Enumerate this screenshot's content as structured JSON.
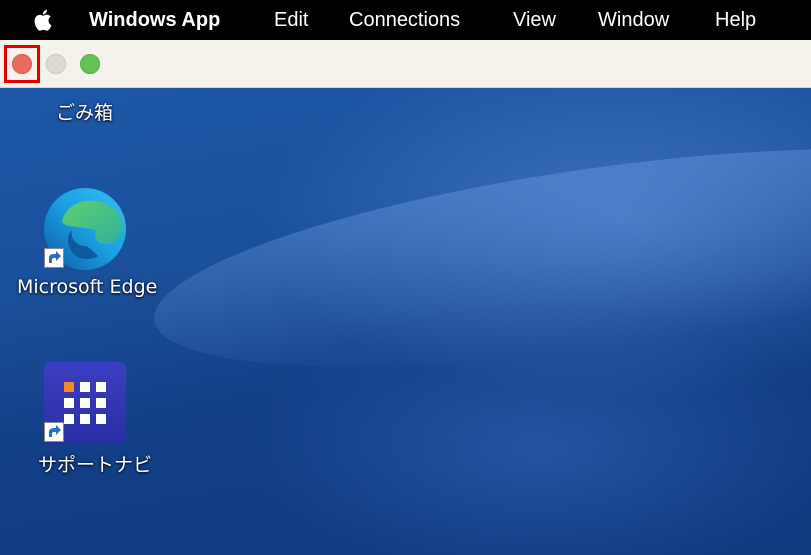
{
  "menubar": {
    "app_name": "Windows App",
    "items": [
      "Edit",
      "Connections",
      "View",
      "Window",
      "Help"
    ],
    "apple_icon": "apple-icon"
  },
  "titlebar": {
    "buttons": [
      "close",
      "minimize",
      "zoom"
    ]
  },
  "desktop": {
    "icons": [
      {
        "label": "ごみ箱",
        "icon": "recycle-bin-icon"
      },
      {
        "label": "Microsoft Edge",
        "icon": "edge-icon"
      },
      {
        "label": "サポートナビ",
        "icon": "support-navi-icon"
      }
    ]
  },
  "colors": {
    "close": "#ec6a5e",
    "minimize": "#dcd9d4",
    "zoom": "#61c554",
    "highlight": "#e00000",
    "desktop": "#1a4f9a"
  }
}
